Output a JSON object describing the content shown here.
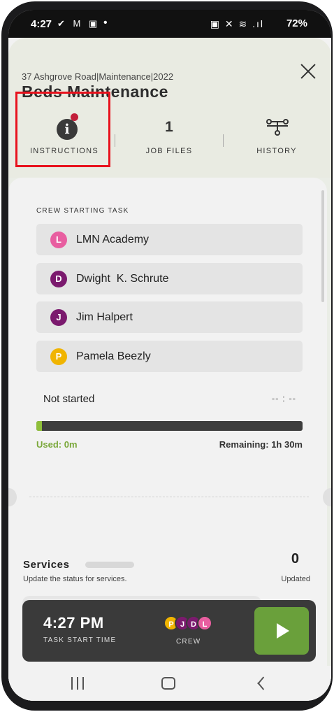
{
  "status_bar": {
    "time": "4:27",
    "left_icons": "✔ M ▣",
    "dot": "•",
    "right_icons": "▣ ✕ ≋ .ıl",
    "battery": "72%"
  },
  "header": {
    "breadcrumb": "37 Ashgrove Road|Maintenance|2022",
    "title": "Beds Maintenance",
    "close_icon": "close-icon"
  },
  "tabs": [
    {
      "label": "INSTRUCTIONS",
      "icon": "info-icon",
      "has_badge": true
    },
    {
      "label": "JOB FILES",
      "count": "1"
    },
    {
      "label": "HISTORY",
      "icon": "history-icon"
    }
  ],
  "crew_section": {
    "label": "CREW STARTING TASK",
    "members": [
      {
        "initial": "L",
        "name": "LMN Academy",
        "color": "#e85ea0"
      },
      {
        "initial": "D",
        "name": "Dwight  K. Schrute",
        "color": "#7b1a6e"
      },
      {
        "initial": "J",
        "name": "Jim Halpert",
        "color": "#7b1a6e"
      },
      {
        "initial": "P",
        "name": "Pamela Beezly",
        "color": "#f0b400"
      }
    ]
  },
  "progress": {
    "status": "Not started",
    "elapsed": "-- : --",
    "used": "Used: 0m",
    "remaining": "Remaining: 1h 30m",
    "fraction": 0.01
  },
  "services": {
    "title": "Services",
    "subtitle": "Update the status for services.",
    "updated_count": "0",
    "updated_label": "Updated"
  },
  "task_panel": {
    "start_time": "4:27 PM",
    "start_label": "TASK START TIME",
    "crew_label": "CREW",
    "crew_initials": [
      {
        "initial": "P",
        "color": "#f0b400"
      },
      {
        "initial": "J",
        "color": "#7b1a6e"
      },
      {
        "initial": "D",
        "color": "#7b1a6e"
      },
      {
        "initial": "L",
        "color": "#e85ea0"
      }
    ],
    "play_icon": "play-icon"
  },
  "colors": {
    "accent_green": "#6aa03b",
    "highlight_red": "#e8121d"
  }
}
